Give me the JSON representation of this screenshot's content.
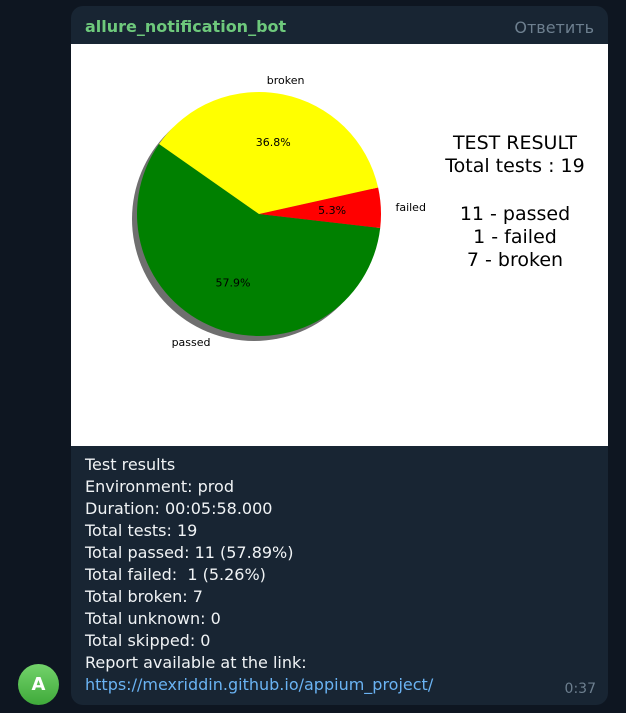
{
  "message": {
    "sender": "allure_notification_bot",
    "reply_label": "Ответить",
    "time": "0:37",
    "avatar_letter": "A",
    "lines": [
      "Test results",
      "Environment: prod",
      "Duration: 00:05:58.000",
      "Total tests: 19",
      "Total passed: 11 (57.89%)",
      "Total failed:  1 (5.26%)",
      "Total broken: 7",
      "Total unknown: 0",
      "Total skipped: 0",
      "Report available at the link:"
    ],
    "link": "https://mexriddin.github.io/appium_project/"
  },
  "chart_data": {
    "type": "pie",
    "slices": [
      {
        "label": "passed",
        "value": 57.9,
        "display": "57.9%",
        "color": "#008000"
      },
      {
        "label": "failed",
        "value": 5.3,
        "display": "5.3%",
        "color": "#ff0000"
      },
      {
        "label": "broken",
        "value": 36.8,
        "display": "36.8%",
        "color": "#ffff00"
      }
    ],
    "summary": {
      "title": "TEST RESULT",
      "total": "Total tests : 19",
      "lines": [
        "11 - passed",
        "1 - failed",
        "7 - broken"
      ]
    }
  }
}
